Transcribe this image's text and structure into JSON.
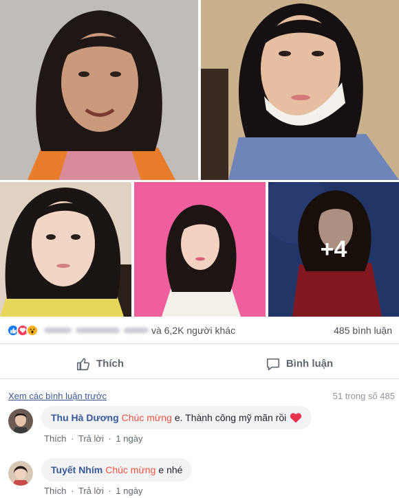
{
  "photos": {
    "more_count": "+4"
  },
  "reactions": {
    "icons": [
      "like-icon",
      "love-icon",
      "wow-icon"
    ],
    "others_text": "và 6,2K người khác",
    "comment_count": "485 bình luận"
  },
  "actions": {
    "like_label": "Thích",
    "comment_label": "Bình luận"
  },
  "comments_header": {
    "view_previous": "Xem các bình luận trước",
    "count_text": "51 trong số 485"
  },
  "comments": [
    {
      "author": "Thu Hà Dương",
      "tag": "Chúc mừng",
      "text": "e. Thành công mỹ mãn rồi",
      "emoji": "heart-icon",
      "like": "Thích",
      "sep": "·",
      "reply": "Trả lời",
      "time": "1 ngày"
    },
    {
      "author": "Tuyết Nhím",
      "tag": "Chúc mừng",
      "text": "e nhé",
      "like": "Thích",
      "sep": "·",
      "reply": "Trả lời",
      "time": "1 ngày"
    }
  ],
  "colors": {
    "link": "#385898",
    "tag": "#f5533d",
    "like_blue": "#1877f2",
    "love_red": "#f33e58",
    "wow_yellow": "#f7b125"
  }
}
